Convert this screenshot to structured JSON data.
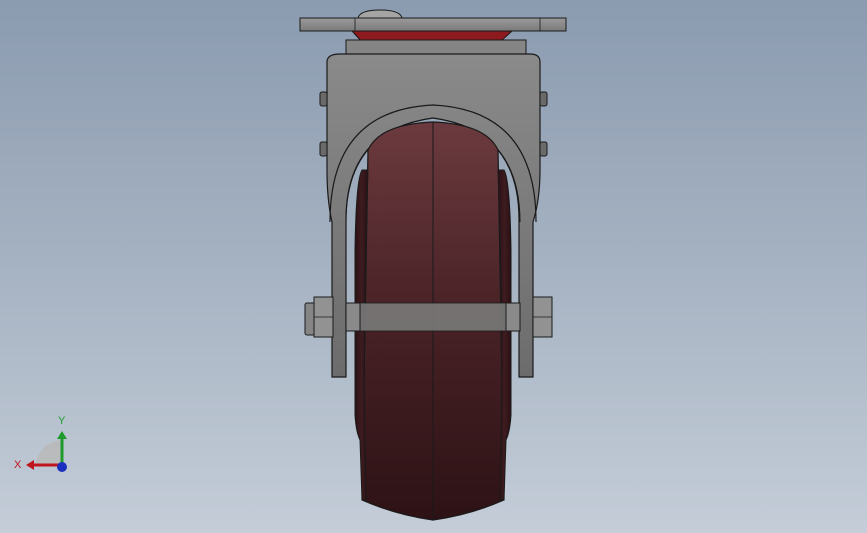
{
  "viewport": {
    "background_top": "#8b9bb0",
    "background_bottom": "#c4cdd8"
  },
  "model": {
    "wheel_color": "#4a2226",
    "frame_color": "#7d7d7d",
    "plate_color": "#8a8a8a",
    "accent_color": "#8c1a1e"
  },
  "triad": {
    "x_label": "X",
    "y_label": "Y",
    "x_color": "#c0161e",
    "y_color": "#1f9a2c",
    "z_color": "#1a2fc0"
  }
}
